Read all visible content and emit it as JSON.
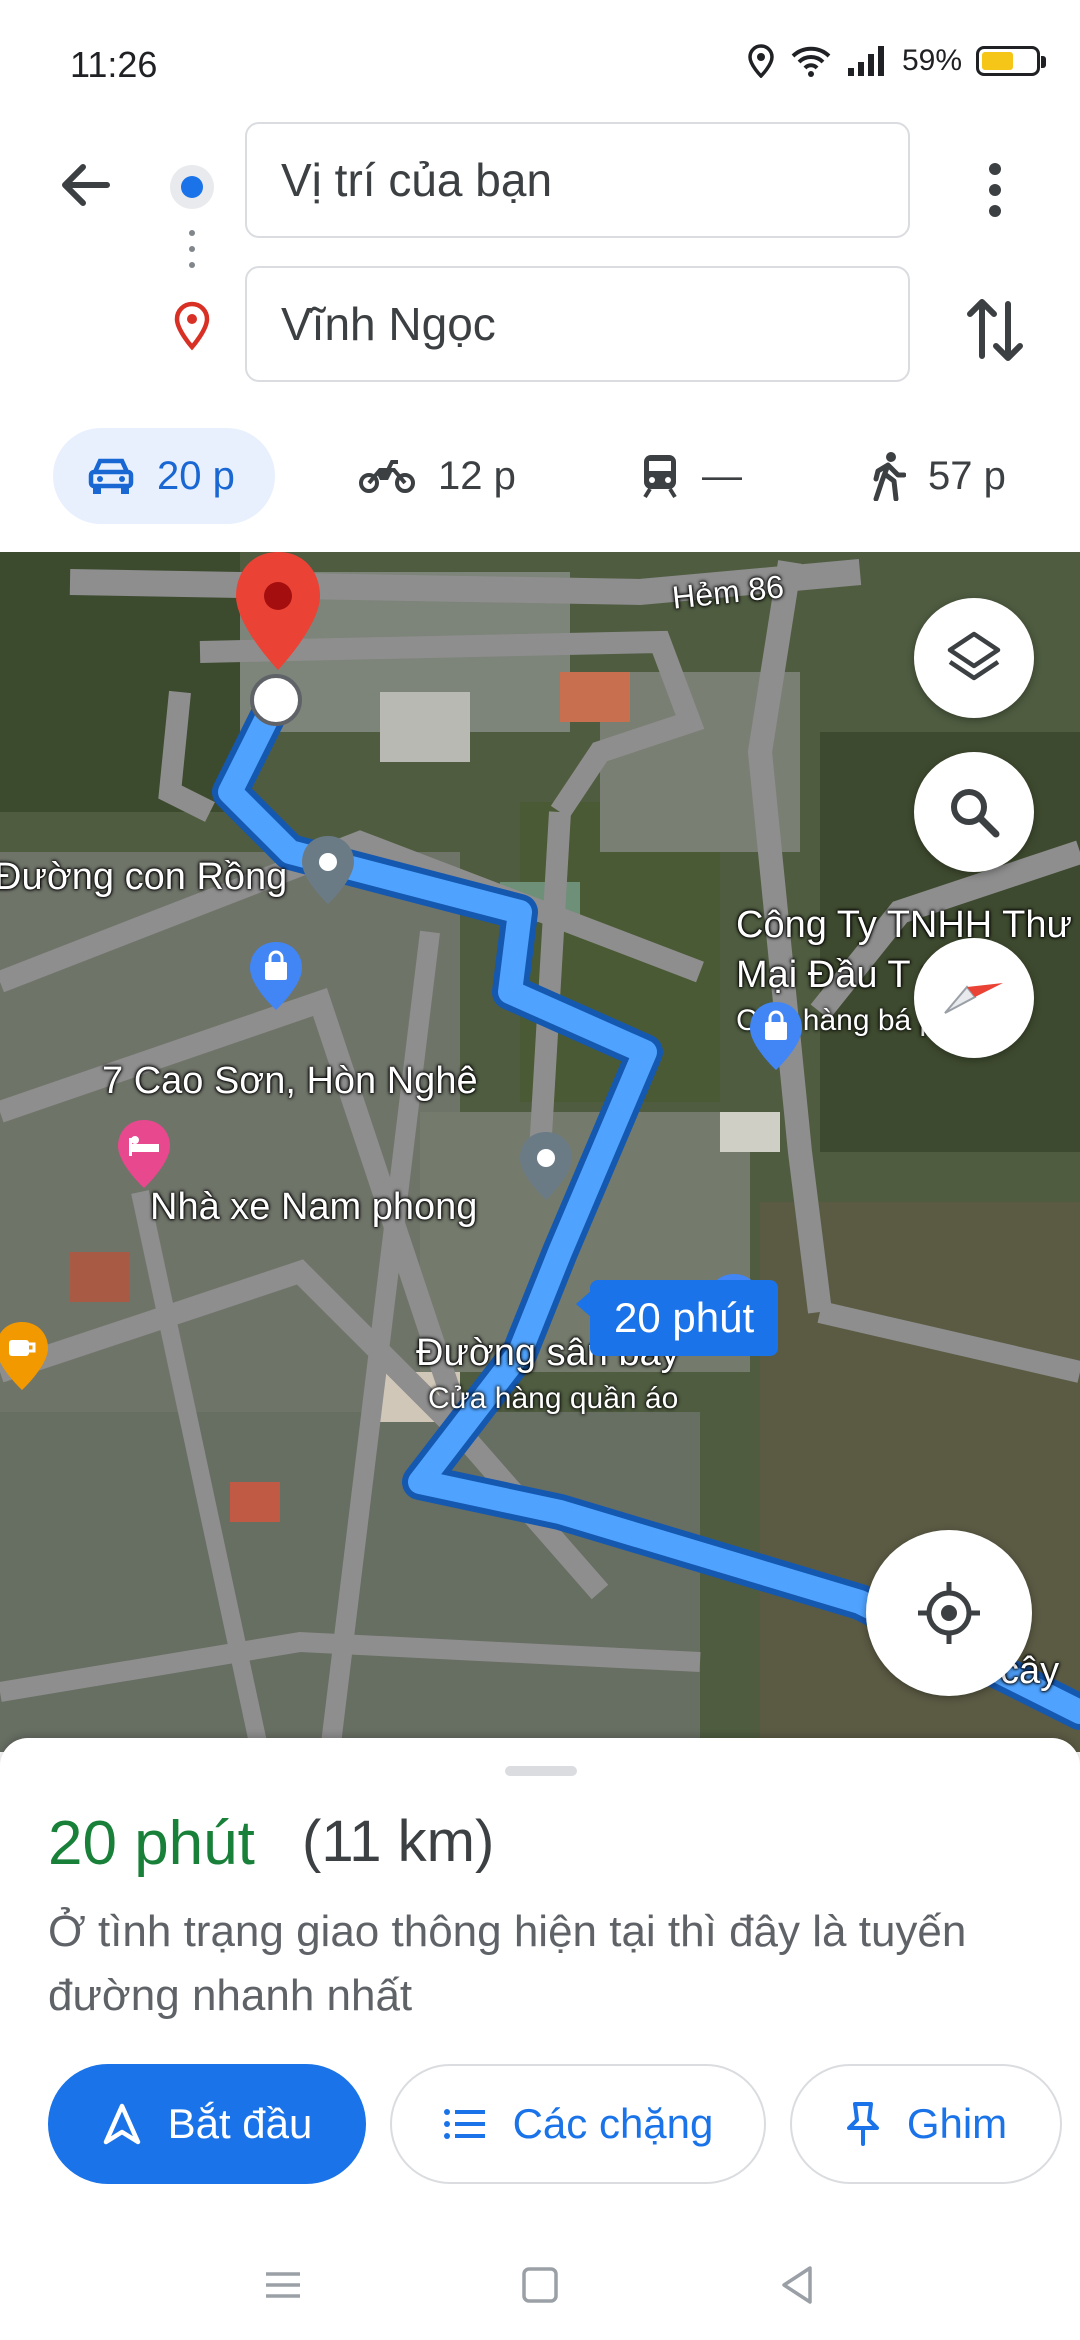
{
  "status_bar": {
    "time": "11:26",
    "battery_text": "59%",
    "battery_level": 0.59,
    "icons": [
      "location-icon",
      "wifi-icon",
      "signal-icon",
      "battery-icon"
    ]
  },
  "directions": {
    "origin": "Vị trí của bạn",
    "destination": "Vĩnh Ngọc",
    "modes": [
      {
        "name": "car",
        "label": "20 p",
        "active": true
      },
      {
        "name": "motorbike",
        "label": "12 p",
        "active": false
      },
      {
        "name": "transit",
        "label": "—",
        "active": false
      },
      {
        "name": "walk",
        "label": "57 p",
        "active": false
      }
    ]
  },
  "map": {
    "labels": {
      "hem": "Hẻm 86",
      "con_rong": "Đường con Rồng",
      "company_1": "Công Ty TNHH Thư",
      "company_2": "Mại Đầu T      ứng",
      "company_sub": "Cửa hàng bá        phẩ",
      "cao_son": "7 Cao Sơn, Hòn Nghê",
      "nha_xe": "Nhà xe Nam phong",
      "san_bay": "Đường sân bay",
      "quan_ao": "Cửa hàng quần áo",
      "cay": "cây"
    },
    "duration_chip": "20 phút",
    "route_color": "#4285f4"
  },
  "summary": {
    "time": "20 phút",
    "distance": "(11 km)",
    "description": "Ở tình trạng giao thông hiện tại thì đây là tuyến đường nhanh nhất",
    "time_color": "#188038"
  },
  "actions": {
    "start": "Bắt đầu",
    "steps": "Các chặng",
    "pin": "Ghim"
  },
  "colors": {
    "accent": "#1a73e8",
    "active_chip_bg": "#e8f0fe"
  }
}
